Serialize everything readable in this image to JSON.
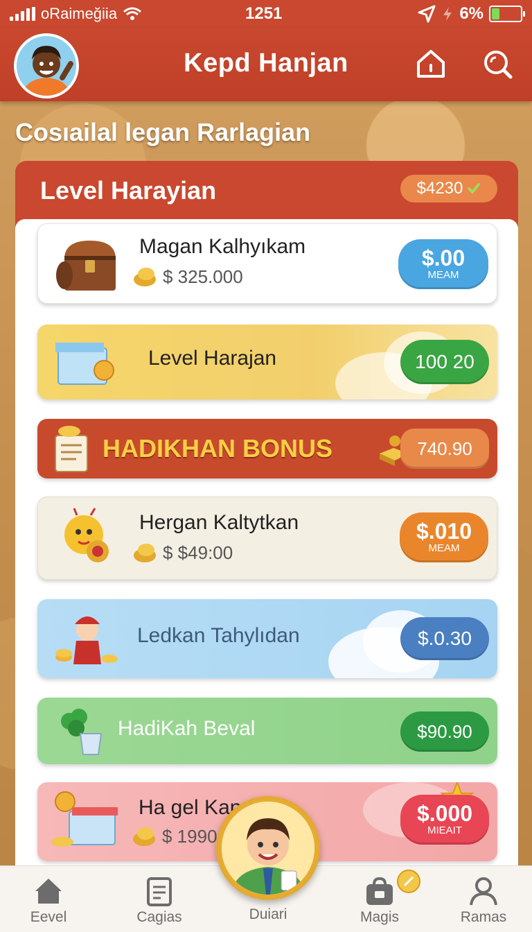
{
  "status_bar": {
    "carrier": "oRaimeğiia",
    "time": "1251",
    "battery": "6%"
  },
  "header": {
    "title": "Kepd Hanjan"
  },
  "section": {
    "title": "Cosıailal legan Rarlagian"
  },
  "panel": {
    "title": "Level Harayian",
    "badge": "$4230"
  },
  "cards": [
    {
      "title": "Magan Kalhyıkam",
      "price": "$ 325.000",
      "button": "$.00",
      "button_sub": "MEAM",
      "color": "#f5f2ec",
      "btn_color": "#4aa6e0"
    },
    {
      "title": "Level Harajan",
      "button": "100 20",
      "color": "#f2d46a",
      "btn_color": "#3aa543"
    },
    {
      "title": "HADIKHAN BONUS",
      "button": "740.90",
      "color": "#c84a2c",
      "btn_color": "#e8894a"
    },
    {
      "title": "Hergan Kaltytkan",
      "price": "$ $49:00",
      "button": "$.010",
      "button_sub": "MEAM",
      "color": "#f4efe3",
      "btn_color": "#e9862c"
    },
    {
      "title": "Ledkan Tahylıdan",
      "button": "$.0.30",
      "color": "#a8d6f2",
      "btn_color": "#4a7fc1"
    },
    {
      "title": "HadiKah Beval",
      "button": "$90.90",
      "color": "#8fd48a",
      "btn_color": "#2c9a43"
    },
    {
      "title": "Ha gel Kanı",
      "price": "$ 1990.0",
      "button": "$.000",
      "button_sub": "MIEAIT",
      "color": "#f6b3b3",
      "btn_color": "#e84555"
    }
  ],
  "nav": [
    {
      "label": "Eevel",
      "icon": "home-icon"
    },
    {
      "label": "Cagias",
      "icon": "document-icon"
    },
    {
      "label": "Duiari",
      "icon": "avatar"
    },
    {
      "label": "Magis",
      "icon": "bag-icon"
    },
    {
      "label": "Ramas",
      "icon": "profile-icon"
    }
  ]
}
